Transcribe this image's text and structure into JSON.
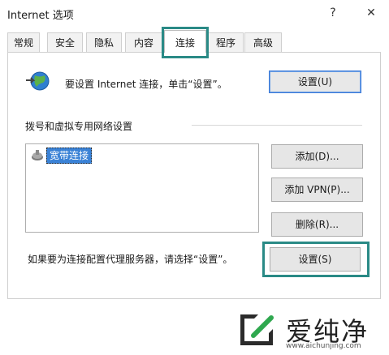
{
  "window": {
    "title": "Internet 选项",
    "help_glyph": "?",
    "close_glyph": "✕"
  },
  "tabs": [
    {
      "label": "常规"
    },
    {
      "label": "安全"
    },
    {
      "label": "隐私"
    },
    {
      "label": "内容"
    },
    {
      "label": "连接",
      "active": true
    },
    {
      "label": "程序"
    },
    {
      "label": "高级"
    }
  ],
  "setup": {
    "text": "要设置 Internet 连接，单击“设置”。",
    "button": "设置(U)"
  },
  "dialup": {
    "section_label": "拨号和虚拟专用网络设置",
    "connections": [
      {
        "label": "宽带连接",
        "selected": true
      }
    ],
    "add_button": "添加(D)...",
    "add_vpn_button": "添加 VPN(P)...",
    "remove_button": "删除(R)..."
  },
  "proxy": {
    "text": "如果要为连接配置代理服务器，请选择“设置”。",
    "button": "设置(S)"
  },
  "watermark": {
    "text": "爱纯净",
    "url": "www.aichunjing.com"
  },
  "colors": {
    "highlight": "#2a8a86",
    "selection": "#3a82d6",
    "focus_border": "#3d7bd8"
  }
}
